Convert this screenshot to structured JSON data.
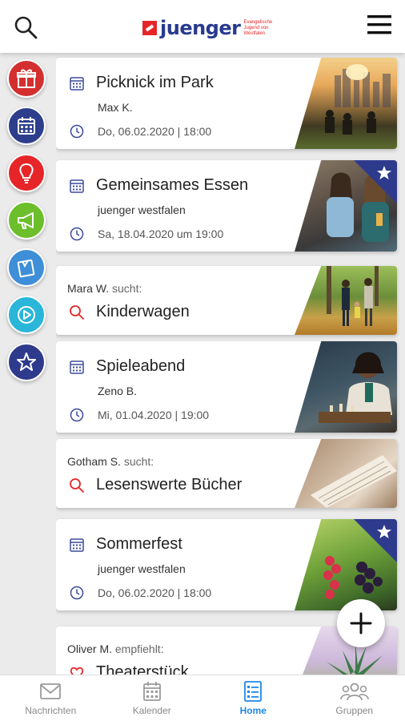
{
  "header": {
    "logo_text": "juenger",
    "logo_sub": "Evangelische Jugend von Westfalen"
  },
  "rail": [
    {
      "name": "gift",
      "color": "#d32f2f"
    },
    {
      "name": "calendar",
      "color": "#2c3e8c"
    },
    {
      "name": "lightbulb",
      "color": "#e52528"
    },
    {
      "name": "megaphone",
      "color": "#6cbf2a"
    },
    {
      "name": "note",
      "color": "#3f8ed8"
    },
    {
      "name": "play",
      "color": "#29b6d8"
    },
    {
      "name": "star",
      "color": "#2e3a8c"
    }
  ],
  "feed": {
    "cards": [
      {
        "type": "event",
        "title": "Picknick im Park",
        "author": "Max K.",
        "date": "Do, 06.02.2020 | 18:00",
        "starred": false
      },
      {
        "type": "event",
        "title": "Gemeinsames Essen",
        "author": "juenger westfalen",
        "date": "Sa, 18.04.2020 um 19:00",
        "starred": true
      },
      {
        "type": "search",
        "seeker": "Mara W.",
        "verb": "sucht:",
        "title": "Kinderwagen"
      },
      {
        "type": "event",
        "title": "Spieleabend",
        "author": "Zeno B.",
        "date": "Mi, 01.04.2020 | 19:00",
        "starred": false
      },
      {
        "type": "search",
        "seeker": "Gotham S.",
        "verb": "sucht:",
        "title": "Lesenswerte Bücher"
      },
      {
        "type": "event",
        "title": "Sommerfest",
        "author": "juenger westfalen",
        "date": "Do, 06.02.2020 | 18:00",
        "starred": true
      },
      {
        "type": "recommend",
        "seeker": "Oliver M.",
        "verb": "empfiehlt:",
        "title": "Theaterstück"
      }
    ]
  },
  "bottom_nav": [
    {
      "label": "Nachrichten",
      "icon": "mail-icon",
      "active": false
    },
    {
      "label": "Kalender",
      "icon": "calendar-icon",
      "active": false
    },
    {
      "label": "Home",
      "icon": "list-icon",
      "active": true
    },
    {
      "label": "Gruppen",
      "icon": "group-icon",
      "active": false
    }
  ],
  "colors": {
    "brand_blue": "#2e3a8c",
    "brand_red": "#e52528",
    "active_nav": "#1e88e5"
  }
}
